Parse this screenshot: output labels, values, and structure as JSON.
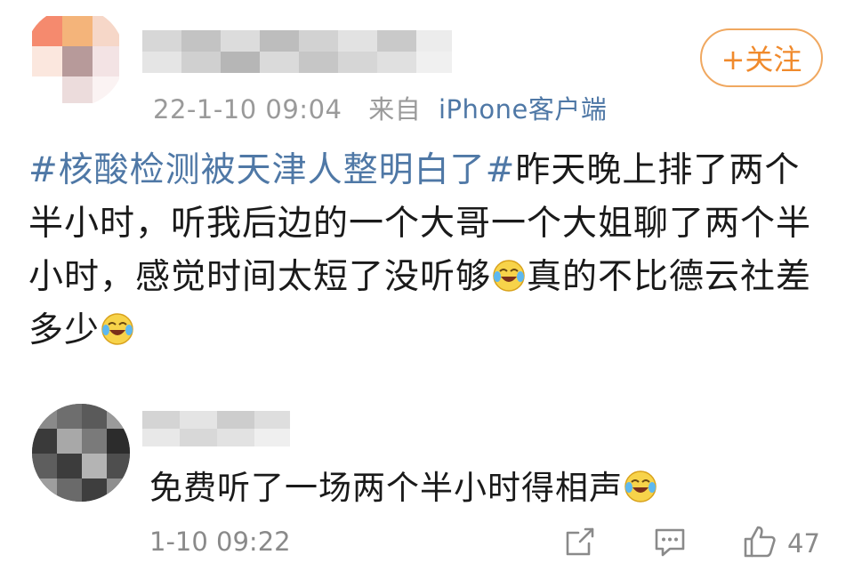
{
  "post": {
    "meta": {
      "timestamp": "22-1-10 09:04",
      "source_label": "来自",
      "client": "iPhone客户端"
    },
    "follow_label": "+关注",
    "hashtag": "#核酸检测被天津人整明白了#",
    "text_part1": "昨天晚上排了两个半小时，听我后边的一个大哥一个大姐聊了两个半小时，感觉时间太短了没听够",
    "text_part2": "真的不比德云社差多少"
  },
  "comment": {
    "text": "免费听了一场两个半小时得相声",
    "time": "1-10 09:22",
    "like_count": "47"
  },
  "icons": {
    "laugh_cry": "laugh-cry-emoji",
    "share": "share-icon",
    "reply": "comment-icon",
    "like": "thumbs-up-icon"
  },
  "colors": {
    "link_blue": "#4f78a6",
    "follow_orange": "#f08a2c",
    "meta_gray": "#9a9a9a"
  }
}
